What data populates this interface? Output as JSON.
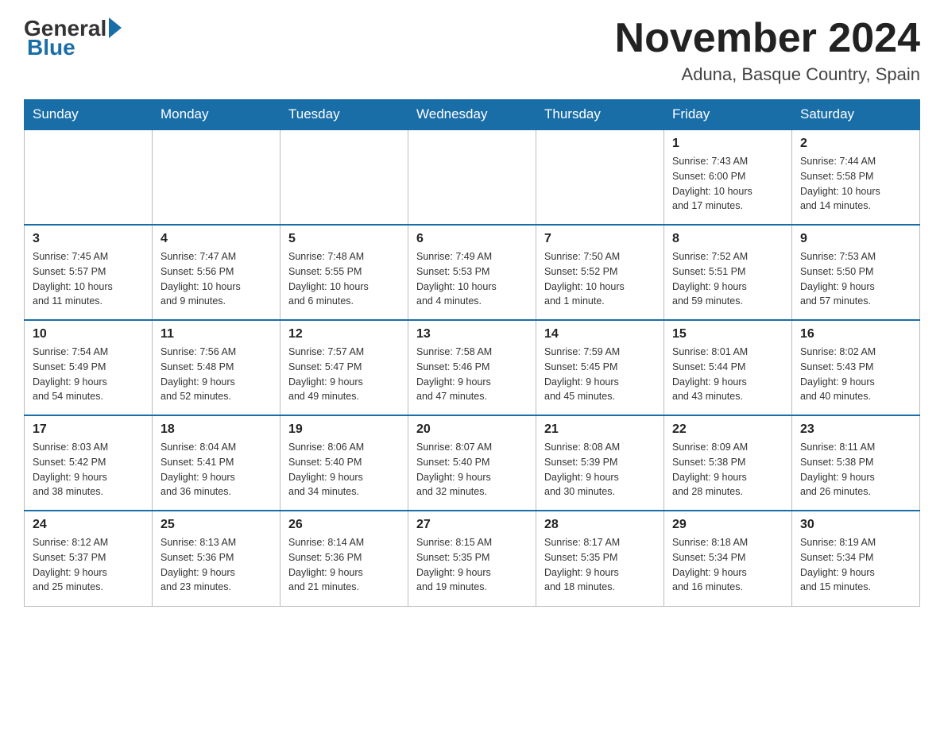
{
  "logo": {
    "general": "General",
    "blue": "Blue"
  },
  "header": {
    "month": "November 2024",
    "location": "Aduna, Basque Country, Spain"
  },
  "weekdays": [
    "Sunday",
    "Monday",
    "Tuesday",
    "Wednesday",
    "Thursday",
    "Friday",
    "Saturday"
  ],
  "weeks": [
    [
      {
        "day": "",
        "info": ""
      },
      {
        "day": "",
        "info": ""
      },
      {
        "day": "",
        "info": ""
      },
      {
        "day": "",
        "info": ""
      },
      {
        "day": "",
        "info": ""
      },
      {
        "day": "1",
        "info": "Sunrise: 7:43 AM\nSunset: 6:00 PM\nDaylight: 10 hours\nand 17 minutes."
      },
      {
        "day": "2",
        "info": "Sunrise: 7:44 AM\nSunset: 5:58 PM\nDaylight: 10 hours\nand 14 minutes."
      }
    ],
    [
      {
        "day": "3",
        "info": "Sunrise: 7:45 AM\nSunset: 5:57 PM\nDaylight: 10 hours\nand 11 minutes."
      },
      {
        "day": "4",
        "info": "Sunrise: 7:47 AM\nSunset: 5:56 PM\nDaylight: 10 hours\nand 9 minutes."
      },
      {
        "day": "5",
        "info": "Sunrise: 7:48 AM\nSunset: 5:55 PM\nDaylight: 10 hours\nand 6 minutes."
      },
      {
        "day": "6",
        "info": "Sunrise: 7:49 AM\nSunset: 5:53 PM\nDaylight: 10 hours\nand 4 minutes."
      },
      {
        "day": "7",
        "info": "Sunrise: 7:50 AM\nSunset: 5:52 PM\nDaylight: 10 hours\nand 1 minute."
      },
      {
        "day": "8",
        "info": "Sunrise: 7:52 AM\nSunset: 5:51 PM\nDaylight: 9 hours\nand 59 minutes."
      },
      {
        "day": "9",
        "info": "Sunrise: 7:53 AM\nSunset: 5:50 PM\nDaylight: 9 hours\nand 57 minutes."
      }
    ],
    [
      {
        "day": "10",
        "info": "Sunrise: 7:54 AM\nSunset: 5:49 PM\nDaylight: 9 hours\nand 54 minutes."
      },
      {
        "day": "11",
        "info": "Sunrise: 7:56 AM\nSunset: 5:48 PM\nDaylight: 9 hours\nand 52 minutes."
      },
      {
        "day": "12",
        "info": "Sunrise: 7:57 AM\nSunset: 5:47 PM\nDaylight: 9 hours\nand 49 minutes."
      },
      {
        "day": "13",
        "info": "Sunrise: 7:58 AM\nSunset: 5:46 PM\nDaylight: 9 hours\nand 47 minutes."
      },
      {
        "day": "14",
        "info": "Sunrise: 7:59 AM\nSunset: 5:45 PM\nDaylight: 9 hours\nand 45 minutes."
      },
      {
        "day": "15",
        "info": "Sunrise: 8:01 AM\nSunset: 5:44 PM\nDaylight: 9 hours\nand 43 minutes."
      },
      {
        "day": "16",
        "info": "Sunrise: 8:02 AM\nSunset: 5:43 PM\nDaylight: 9 hours\nand 40 minutes."
      }
    ],
    [
      {
        "day": "17",
        "info": "Sunrise: 8:03 AM\nSunset: 5:42 PM\nDaylight: 9 hours\nand 38 minutes."
      },
      {
        "day": "18",
        "info": "Sunrise: 8:04 AM\nSunset: 5:41 PM\nDaylight: 9 hours\nand 36 minutes."
      },
      {
        "day": "19",
        "info": "Sunrise: 8:06 AM\nSunset: 5:40 PM\nDaylight: 9 hours\nand 34 minutes."
      },
      {
        "day": "20",
        "info": "Sunrise: 8:07 AM\nSunset: 5:40 PM\nDaylight: 9 hours\nand 32 minutes."
      },
      {
        "day": "21",
        "info": "Sunrise: 8:08 AM\nSunset: 5:39 PM\nDaylight: 9 hours\nand 30 minutes."
      },
      {
        "day": "22",
        "info": "Sunrise: 8:09 AM\nSunset: 5:38 PM\nDaylight: 9 hours\nand 28 minutes."
      },
      {
        "day": "23",
        "info": "Sunrise: 8:11 AM\nSunset: 5:38 PM\nDaylight: 9 hours\nand 26 minutes."
      }
    ],
    [
      {
        "day": "24",
        "info": "Sunrise: 8:12 AM\nSunset: 5:37 PM\nDaylight: 9 hours\nand 25 minutes."
      },
      {
        "day": "25",
        "info": "Sunrise: 8:13 AM\nSunset: 5:36 PM\nDaylight: 9 hours\nand 23 minutes."
      },
      {
        "day": "26",
        "info": "Sunrise: 8:14 AM\nSunset: 5:36 PM\nDaylight: 9 hours\nand 21 minutes."
      },
      {
        "day": "27",
        "info": "Sunrise: 8:15 AM\nSunset: 5:35 PM\nDaylight: 9 hours\nand 19 minutes."
      },
      {
        "day": "28",
        "info": "Sunrise: 8:17 AM\nSunset: 5:35 PM\nDaylight: 9 hours\nand 18 minutes."
      },
      {
        "day": "29",
        "info": "Sunrise: 8:18 AM\nSunset: 5:34 PM\nDaylight: 9 hours\nand 16 minutes."
      },
      {
        "day": "30",
        "info": "Sunrise: 8:19 AM\nSunset: 5:34 PM\nDaylight: 9 hours\nand 15 minutes."
      }
    ]
  ]
}
